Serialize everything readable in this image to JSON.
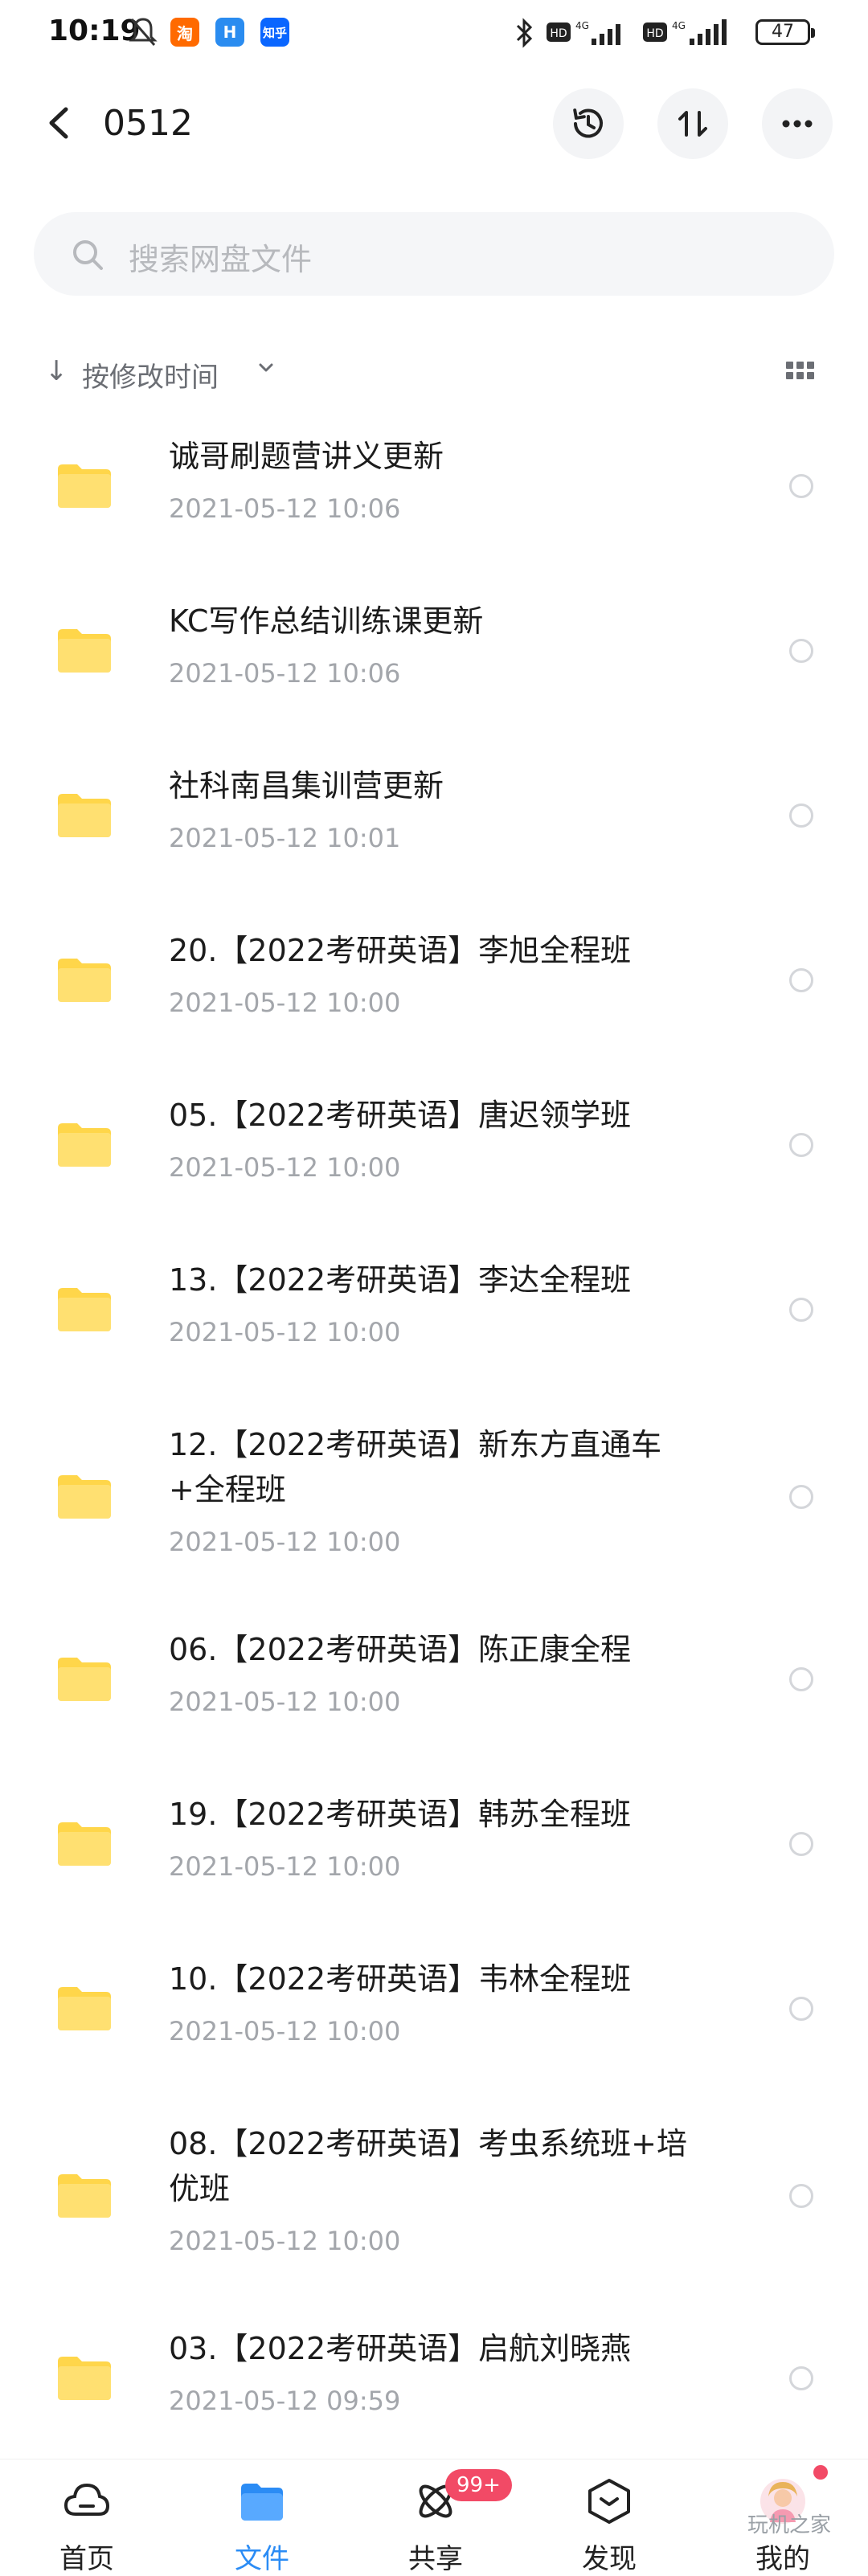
{
  "status": {
    "time": "10:19",
    "app_icons": [
      {
        "icon": "bell-off-icon"
      },
      {
        "label": "淘",
        "color": "#ff6a00"
      },
      {
        "label": "H",
        "color": "#2a8cf0"
      },
      {
        "label": "知乎",
        "color": "#0a66ff"
      }
    ],
    "battery": "47"
  },
  "header": {
    "title": "0512"
  },
  "search": {
    "placeholder": "搜索网盘文件"
  },
  "sort": {
    "label": "按修改时间"
  },
  "files": [
    {
      "name": "诚哥刷题营讲义更新",
      "date": "2021-05-12  10:06"
    },
    {
      "name": "KC写作总结训练课更新",
      "date": "2021-05-12  10:06"
    },
    {
      "name": "社科南昌集训营更新",
      "date": "2021-05-12  10:01"
    },
    {
      "name": "20.【2022考研英语】李旭全程班",
      "date": "2021-05-12  10:00"
    },
    {
      "name": "05.【2022考研英语】唐迟领学班",
      "date": "2021-05-12  10:00"
    },
    {
      "name": "13.【2022考研英语】李达全程班",
      "date": "2021-05-12  10:00"
    },
    {
      "name": "12.【2022考研英语】新东方直通车+全程班",
      "date": "2021-05-12  10:00"
    },
    {
      "name": "06.【2022考研英语】陈正康全程",
      "date": "2021-05-12  10:00"
    },
    {
      "name": "19.【2022考研英语】韩苏全程班",
      "date": "2021-05-12  10:00"
    },
    {
      "name": "10.【2022考研英语】韦林全程班",
      "date": "2021-05-12  10:00"
    },
    {
      "name": "08.【2022考研英语】考虫系统班+培优班",
      "date": "2021-05-12  10:00"
    },
    {
      "name": "03.【2022考研英语】启航刘晓燕",
      "date": "2021-05-12  09:59"
    }
  ],
  "nav": {
    "items": [
      {
        "label": "首页",
        "icon": "cloud-home-icon"
      },
      {
        "label": "文件",
        "icon": "folder-icon"
      },
      {
        "label": "共享",
        "icon": "share-atom-icon",
        "badge": "99+"
      },
      {
        "label": "发现",
        "icon": "discover-box-icon"
      },
      {
        "label": "我的",
        "icon": "avatar-icon"
      }
    ]
  },
  "watermark": "玩机之家",
  "colors": {
    "accent": "#2b8cf5",
    "folder": "#ffd64a",
    "badge": "#f24a66"
  }
}
